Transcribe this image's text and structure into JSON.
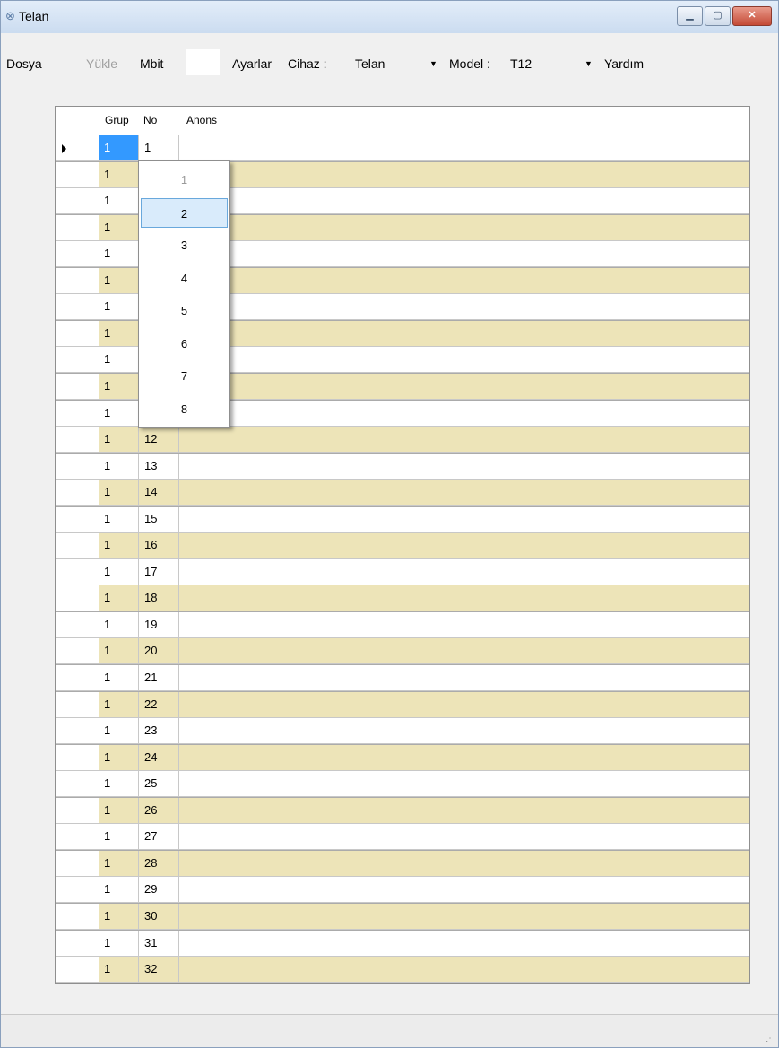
{
  "window": {
    "title": "Telan"
  },
  "menu": {
    "dosya": "Dosya",
    "yukle": "Yükle",
    "mbit": "Mbit",
    "ayarlar": "Ayarlar",
    "cihaz_label": "Cihaz :",
    "cihaz_value": "Telan",
    "model_label": "Model :",
    "model_value": "T12",
    "yardim": "Yardım"
  },
  "grid": {
    "columns": [
      "Grup",
      "No",
      "Anons"
    ],
    "rows": [
      {
        "grup": "1",
        "no": "1",
        "anons": ""
      },
      {
        "grup": "1",
        "no": "",
        "anons": ""
      },
      {
        "grup": "1",
        "no": "",
        "anons": ""
      },
      {
        "grup": "1",
        "no": "",
        "anons": ""
      },
      {
        "grup": "1",
        "no": "",
        "anons": ""
      },
      {
        "grup": "1",
        "no": "",
        "anons": ""
      },
      {
        "grup": "1",
        "no": "",
        "anons": ""
      },
      {
        "grup": "1",
        "no": "",
        "anons": ""
      },
      {
        "grup": "1",
        "no": "",
        "anons": ""
      },
      {
        "grup": "1",
        "no": "",
        "anons": ""
      },
      {
        "grup": "1",
        "no": "",
        "anons": ""
      },
      {
        "grup": "1",
        "no": "12",
        "anons": ""
      },
      {
        "grup": "1",
        "no": "13",
        "anons": ""
      },
      {
        "grup": "1",
        "no": "14",
        "anons": ""
      },
      {
        "grup": "1",
        "no": "15",
        "anons": ""
      },
      {
        "grup": "1",
        "no": "16",
        "anons": ""
      },
      {
        "grup": "1",
        "no": "17",
        "anons": ""
      },
      {
        "grup": "1",
        "no": "18",
        "anons": ""
      },
      {
        "grup": "1",
        "no": "19",
        "anons": ""
      },
      {
        "grup": "1",
        "no": "20",
        "anons": ""
      },
      {
        "grup": "1",
        "no": "21",
        "anons": ""
      },
      {
        "grup": "1",
        "no": "22",
        "anons": ""
      },
      {
        "grup": "1",
        "no": "23",
        "anons": ""
      },
      {
        "grup": "1",
        "no": "24",
        "anons": ""
      },
      {
        "grup": "1",
        "no": "25",
        "anons": ""
      },
      {
        "grup": "1",
        "no": "26",
        "anons": ""
      },
      {
        "grup": "1",
        "no": "27",
        "anons": ""
      },
      {
        "grup": "1",
        "no": "28",
        "anons": ""
      },
      {
        "grup": "1",
        "no": "29",
        "anons": ""
      },
      {
        "grup": "1",
        "no": "30",
        "anons": ""
      },
      {
        "grup": "1",
        "no": "31",
        "anons": ""
      },
      {
        "grup": "1",
        "no": "32",
        "anons": ""
      }
    ]
  },
  "dropdown": {
    "options": [
      "1",
      "2",
      "3",
      "4",
      "5",
      "6",
      "7",
      "8"
    ],
    "highlighted": "2"
  },
  "colors": {
    "row_alt": "#ede4b8",
    "selection": "#3399ff"
  }
}
